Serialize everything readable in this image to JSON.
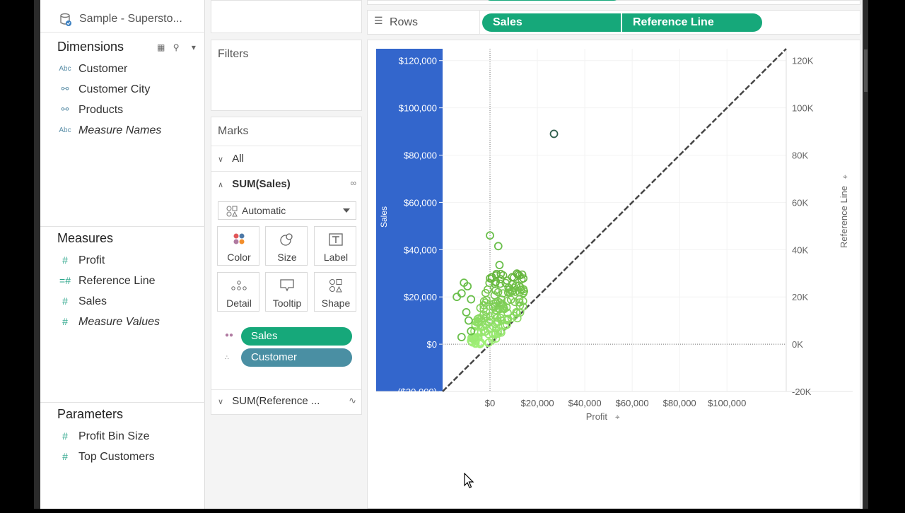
{
  "datasource": {
    "name": "Sample - Supersto..."
  },
  "dimensions": {
    "title": "Dimensions",
    "fields": [
      {
        "label": "Customer",
        "icon": "Abc",
        "type": "string",
        "italic": false
      },
      {
        "label": "Customer City",
        "icon": "hierarchy-icon",
        "type": "geo",
        "italic": false
      },
      {
        "label": "Products",
        "icon": "hierarchy-icon",
        "type": "geo",
        "italic": false
      },
      {
        "label": "Measure Names",
        "icon": "Abc",
        "type": "string",
        "italic": true
      }
    ]
  },
  "measures": {
    "title": "Measures",
    "fields": [
      {
        "label": "Profit",
        "icon": "#",
        "italic": false
      },
      {
        "label": "Reference Line",
        "icon": "=#",
        "italic": false
      },
      {
        "label": "Sales",
        "icon": "#",
        "italic": false
      },
      {
        "label": "Measure Values",
        "icon": "#",
        "italic": true
      }
    ]
  },
  "parameters": {
    "title": "Parameters",
    "fields": [
      {
        "label": "Profit Bin Size",
        "icon": "#"
      },
      {
        "label": "Top Customers",
        "icon": "#"
      }
    ]
  },
  "filters": {
    "title": "Filters"
  },
  "marks": {
    "title": "Marks",
    "all_label": "All",
    "sum_sales_label": "SUM(Sales)",
    "mark_type": "Automatic",
    "buttons": [
      "Color",
      "Size",
      "Label",
      "Detail",
      "Tooltip",
      "Shape"
    ],
    "pills": [
      {
        "label": "Sales",
        "color": "#16a87a"
      },
      {
        "label": "Customer",
        "color": "#4a8fa3"
      }
    ],
    "sum_ref_label": "SUM(Reference ..."
  },
  "rows_shelf": {
    "label": "Rows",
    "pills": [
      "Sales",
      "Reference Line"
    ]
  },
  "colors": {
    "accent_green": "#16a87a",
    "axis_highlight": "#3366cc",
    "mark_green": "#6abf4b"
  },
  "chart_data": {
    "type": "scatter",
    "xlabel": "Profit",
    "ylabel": "Sales",
    "y2label": "Reference Line",
    "xlim": [
      -20000,
      125000
    ],
    "ylim": [
      -20000,
      125000
    ],
    "x_ticks": [
      "$0",
      "$20,000",
      "$40,000",
      "$60,000",
      "$80,000",
      "$100,000"
    ],
    "x_tick_values": [
      0,
      20000,
      40000,
      60000,
      80000,
      100000
    ],
    "y_ticks": [
      "($20,000)",
      "$0",
      "$20,000",
      "$40,000",
      "$60,000",
      "$80,000",
      "$100,000",
      "$120,000"
    ],
    "y_tick_values": [
      -20000,
      0,
      20000,
      40000,
      60000,
      80000,
      100000,
      120000
    ],
    "y2_ticks": [
      "-20K",
      "0K",
      "20K",
      "40K",
      "60K",
      "80K",
      "100K",
      "120K"
    ],
    "reference_line": {
      "x": [
        -20000,
        125000
      ],
      "y": [
        -20000,
        125000
      ],
      "style": "dashed"
    },
    "outliers": [
      {
        "x": 27000,
        "y": 89000
      },
      {
        "x": 0,
        "y": 46000
      },
      {
        "x": 3500,
        "y": 41500
      },
      {
        "x": 4000,
        "y": 33500
      },
      {
        "x": -11000,
        "y": 26000
      },
      {
        "x": -9500,
        "y": 24500
      },
      {
        "x": -12000,
        "y": 21500
      },
      {
        "x": -14000,
        "y": 20000
      },
      {
        "x": -8000,
        "y": 19000
      },
      {
        "x": -10000,
        "y": 13500
      },
      {
        "x": -9000,
        "y": 10000
      },
      {
        "x": -12000,
        "y": 3000
      },
      {
        "x": -8000,
        "y": 5500
      }
    ],
    "cluster": {
      "x_range": [
        -8000,
        15000
      ],
      "y_range": [
        0,
        30000
      ],
      "count": 170
    }
  }
}
